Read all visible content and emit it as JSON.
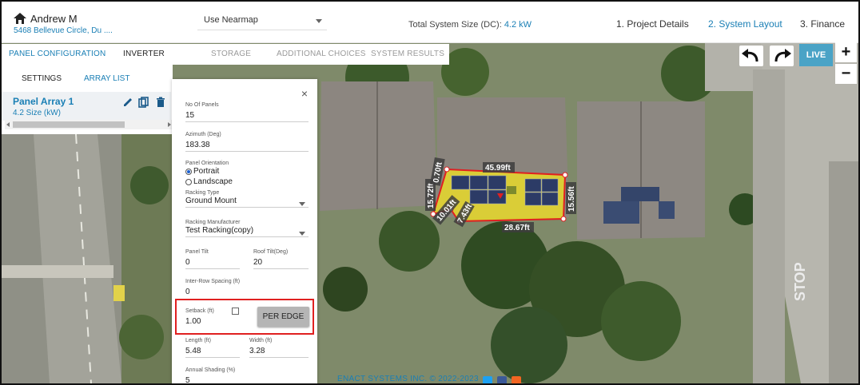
{
  "header": {
    "user_name": "Andrew M",
    "address": "5468 Bellevue Circle, Du ....",
    "map_source": "Use Nearmap",
    "system_size_label": "Total System Size (DC):",
    "system_size_value": "4.2 kW",
    "steps": [
      "1. Project Details",
      "2. System Layout",
      "3. Finance"
    ],
    "active_step": "2. System Layout"
  },
  "tabs": {
    "items": [
      "PANEL CONFIGURATION",
      "INVERTER",
      "STORAGE",
      "ADDITIONAL CHOICES",
      "SYSTEM RESULTS"
    ],
    "active": "PANEL CONFIGURATION"
  },
  "subtabs": {
    "items": [
      "SETTINGS",
      "ARRAY LIST"
    ],
    "active": "ARRAY LIST"
  },
  "array": {
    "title": "Panel Array 1",
    "size": "4.2 Size (kW)"
  },
  "form": {
    "close": "×",
    "no_of_panels": {
      "label": "No Of Panels",
      "value": "15"
    },
    "azimuth": {
      "label": "Azimuth (Deg)",
      "value": "183.38"
    },
    "orientation": {
      "label": "Panel Orientation",
      "options": [
        "Portrait",
        "Landscape"
      ],
      "selected": "Portrait"
    },
    "racking_type": {
      "label": "Racking Type",
      "value": "Ground Mount"
    },
    "racking_manufacturer": {
      "label": "Racking Manufacturer",
      "value": "Test Racking(copy)"
    },
    "panel_tilt": {
      "label": "Panel Tilt",
      "value": "0"
    },
    "roof_tilt": {
      "label": "Roof Tilt(Deg)",
      "value": "20"
    },
    "inter_row": {
      "label": "Inter-Row Spacing (ft)",
      "value": "0"
    },
    "setback": {
      "label": "Setback (ft)",
      "value": "1.00",
      "checked": false
    },
    "per_edge_label": "PER EDGE",
    "length": {
      "label": "Length (ft)",
      "value": "5.48"
    },
    "width": {
      "label": "Width (ft)",
      "value": "3.28"
    },
    "annual_shading": {
      "label": "Annual Shading (%)",
      "value": "5"
    }
  },
  "map": {
    "dimensions": [
      "45.99ft",
      "15.56ft",
      "28.67ft",
      "15.72ft",
      "10.01ft",
      "7.43ft",
      "0.70ft"
    ],
    "live_label": "LIVE",
    "zoom_in": "+",
    "zoom_out": "−",
    "road_text": "STOP"
  },
  "footer": {
    "text": "ENACT SYSTEMS INC. © 2022-2023"
  },
  "colors": {
    "accent": "#1a7fb5",
    "live": "#4aa3c6",
    "highlight": "#e02020",
    "array_fill": "#e8d92a"
  }
}
